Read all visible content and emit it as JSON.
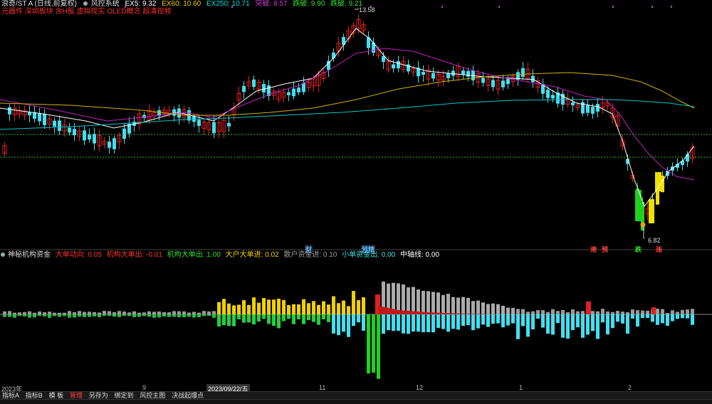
{
  "header": {
    "title": "浪奇/ST A (日线,前复权)",
    "system": "风控系统",
    "ma": [
      {
        "label": "EX5: 9.32",
        "color": "#ffffff"
      },
      {
        "label": "EX60: 10.60",
        "color": "#f0d000"
      },
      {
        "label": "EX250: 10.71",
        "color": "#00e0e0"
      },
      {
        "label": "突破: 8.57",
        "color": "#d040d0"
      },
      {
        "label": "跌破: 9.90",
        "color": "#30e030"
      },
      {
        "label": "跌破: 9.21",
        "color": "#30e030"
      }
    ],
    "concepts": "元器件  深圳板块  含H股  虚拟现实  OLED概念  超清视频"
  },
  "price": {
    "high_label": "13.58",
    "low_label": "6.82"
  },
  "markers": [
    {
      "text": "财",
      "color": "#5bb5ff"
    },
    {
      "text": "预精",
      "color": "#5bb5ff"
    },
    {
      "text": "港",
      "color": "#ff4040"
    },
    {
      "text": "预",
      "color": "#ff4040"
    },
    {
      "text": "跌",
      "color": "#30e030"
    },
    {
      "text": "涨",
      "color": "#ff4040"
    }
  ],
  "indicator": {
    "name": "神秘机构资金",
    "items": [
      {
        "label": "大单动向: 0.05",
        "color": "#ff3030"
      },
      {
        "label": "机构大单出: -0.01",
        "color": "#ff3030"
      },
      {
        "label": "机构大单出: 1.00",
        "color": "#30e030"
      },
      {
        "label": "大户大单进: 0.02",
        "color": "#f0d000"
      },
      {
        "label": "散户资金进: 0.10",
        "color": "#9a9a9a"
      },
      {
        "label": "小单资金出: 0.00",
        "color": "#40e0e0"
      },
      {
        "label": "中轴线: 0.00",
        "color": "#ffffff"
      }
    ]
  },
  "date_axis": [
    "2023年",
    "9",
    "2023/09/22/五",
    "11",
    "12",
    "1",
    "2"
  ],
  "toolbar": [
    "指标A",
    "指标B",
    "模 板",
    "管理",
    "另存为",
    "绑定到",
    "风控主图",
    "决战起爆点"
  ],
  "colors": {
    "up": "#e02020",
    "down": "#40e0f0",
    "ma5": "#ffffff",
    "ma60": "#d4b000",
    "ma250": "#00c8c8",
    "magenta": "#c020c0",
    "guide": "#30c030"
  }
}
